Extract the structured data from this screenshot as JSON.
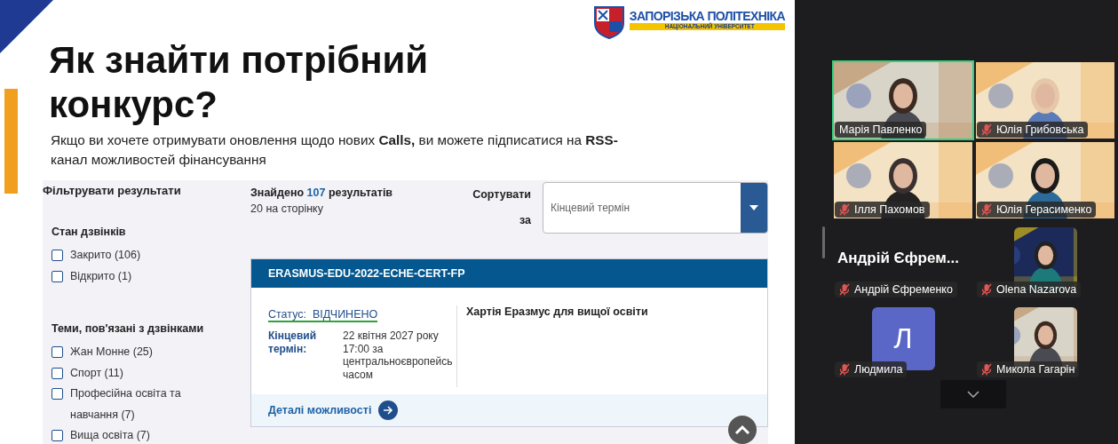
{
  "slide": {
    "logo": {
      "name": "ЗАПОРІЗЬКА ПОЛІТЕХНІКА",
      "tagline": "НАЦІОНАЛЬНИЙ УНІВЕРСИТЕТ"
    },
    "title": "Як знайти потрібний конкурс?",
    "subtitle": "Якщо ви хочете отримувати оновлення щодо нових **Calls,** ви можете підписатися на  **RSS-** канал можливостей фінансування"
  },
  "website": {
    "filter_title": "Фільтрувати результати",
    "filter_groups": [
      {
        "title": "Стан дзвінків",
        "options": [
          {
            "label": "Закрито (106)",
            "checked": false
          },
          {
            "label": "Відкрито (1)",
            "checked": false
          }
        ]
      },
      {
        "title": "Теми, пов'язані з дзвінками",
        "options": [
          {
            "label": "Жан Монне (25)",
            "checked": false
          },
          {
            "label": "Спорт (11)",
            "checked": false
          },
          {
            "label": "Професійна освіта та навчання (7)",
            "checked": false
          },
          {
            "label": "Вища освіта (7)",
            "checked": false
          }
        ]
      }
    ],
    "results": "Знайдено **107** результатів",
    "per_page": "20 на сторінку",
    "sort": {
      "label": "Сортувати за",
      "placeholder": "Кінцевий термін"
    },
    "card": {
      "code": "ERASMUS-EDU-2022-ECHE-CERT-FP",
      "status_label": "Статус:",
      "status": "ВІДЧИНЕНО",
      "deadline_label": "Кінцевий термін:",
      "deadline": "22 квітня 2027 року 17:00 за центральноєвропейсь часом",
      "title": "Хартія Еразмус для вищої освіти",
      "link": "Деталі можливості"
    }
  },
  "participants": [
    {
      "name": "Марія Павленко",
      "kind": "video",
      "muted": false,
      "speaking": true
    },
    {
      "name": "Юлія Грибовська",
      "kind": "video",
      "muted": true,
      "speaking": false
    },
    {
      "name": "Ілля Пахомов",
      "kind": "video",
      "muted": true,
      "speaking": false
    },
    {
      "name": "Юлія Герасименко",
      "kind": "video",
      "muted": true,
      "speaking": false
    },
    {
      "name": "Андрій Єфременко",
      "kind": "name",
      "display": "Андрій Єфрем...",
      "muted": true
    },
    {
      "name": "Olena Nazarova",
      "muted": true
    },
    {
      "name": "Людмила",
      "kind": "avatar",
      "initial": "Л",
      "muted": true
    },
    {
      "name": "Микола Гагарін",
      "muted": true
    }
  ]
}
